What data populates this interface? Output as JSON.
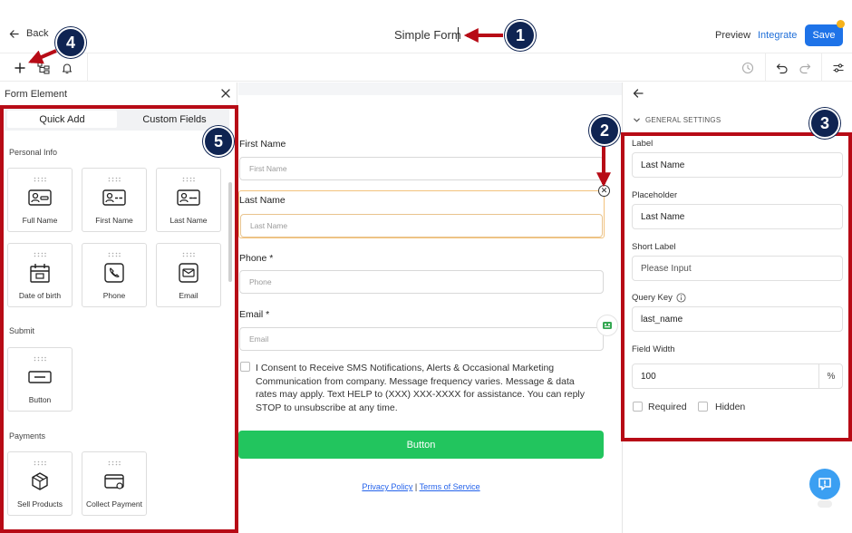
{
  "header": {
    "back_label": "Back",
    "form_title": "Simple Form",
    "preview_label": "Preview",
    "integrate_label": "Integrate",
    "save_label": "Save"
  },
  "toolbar": {
    "left_icons": [
      "plus-icon",
      "layers-icon",
      "bell-icon"
    ],
    "right_icons": [
      "history-icon",
      "undo-icon",
      "redo-icon",
      "sliders-icon"
    ]
  },
  "left_panel": {
    "title": "Form Element",
    "tabs": [
      {
        "label": "Quick Add",
        "active": true
      },
      {
        "label": "Custom Fields",
        "active": false
      }
    ],
    "sections": [
      {
        "title": "Personal Info",
        "items": [
          {
            "label": "Full Name",
            "icon": "id-card-icon"
          },
          {
            "label": "First Name",
            "icon": "id-card-icon"
          },
          {
            "label": "Last Name",
            "icon": "id-card-icon"
          },
          {
            "label": "Date of birth",
            "icon": "calendar-icon"
          },
          {
            "label": "Phone",
            "icon": "phone-icon"
          },
          {
            "label": "Email",
            "icon": "mail-icon"
          }
        ]
      },
      {
        "title": "Submit",
        "items": [
          {
            "label": "Button",
            "icon": "button-icon"
          }
        ]
      },
      {
        "title": "Payments",
        "items": [
          {
            "label": "Sell Products",
            "icon": "box-icon"
          },
          {
            "label": "Collect Payment",
            "icon": "card-icon"
          }
        ]
      }
    ]
  },
  "form": {
    "fields": [
      {
        "label": "First Name",
        "placeholder": "First Name"
      },
      {
        "label": "Last Name",
        "placeholder": "Last Name",
        "selected": true
      },
      {
        "label": "Phone *",
        "placeholder": "Phone"
      },
      {
        "label": "Email *",
        "placeholder": "Email"
      }
    ],
    "consent_text": "I Consent to Receive SMS Notifications, Alerts & Occasional Marketing Communication from company. Message frequency varies. Message & data rates may apply. Text HELP to (XXX) XXX-XXXX for assistance. You can reply STOP to unsubscribe at any time.",
    "submit_label": "Button",
    "privacy_label": "Privacy Policy",
    "separator": "|",
    "terms_label": "Terms of Service"
  },
  "right_panel": {
    "section_title": "GENERAL SETTINGS",
    "label_title": "Label",
    "label_value": "Last Name",
    "placeholder_title": "Placeholder",
    "placeholder_value": "Last Name",
    "short_label_title": "Short Label",
    "short_label_placeholder": "Please Input",
    "query_key_title": "Query Key",
    "query_key_value": "last_name",
    "field_width_title": "Field Width",
    "field_width_value": "100",
    "field_width_suffix": "%",
    "required_label": "Required",
    "hidden_label": "Hidden"
  },
  "annotations": [
    {
      "number": "1"
    },
    {
      "number": "2"
    },
    {
      "number": "3"
    },
    {
      "number": "4"
    },
    {
      "number": "5"
    }
  ],
  "colors": {
    "accent_blue": "#1e73e8",
    "submit_green": "#22c55e",
    "annotation_red": "#b70b16",
    "badge_navy": "#0f2452",
    "selection_orange": "#f2c27d"
  }
}
